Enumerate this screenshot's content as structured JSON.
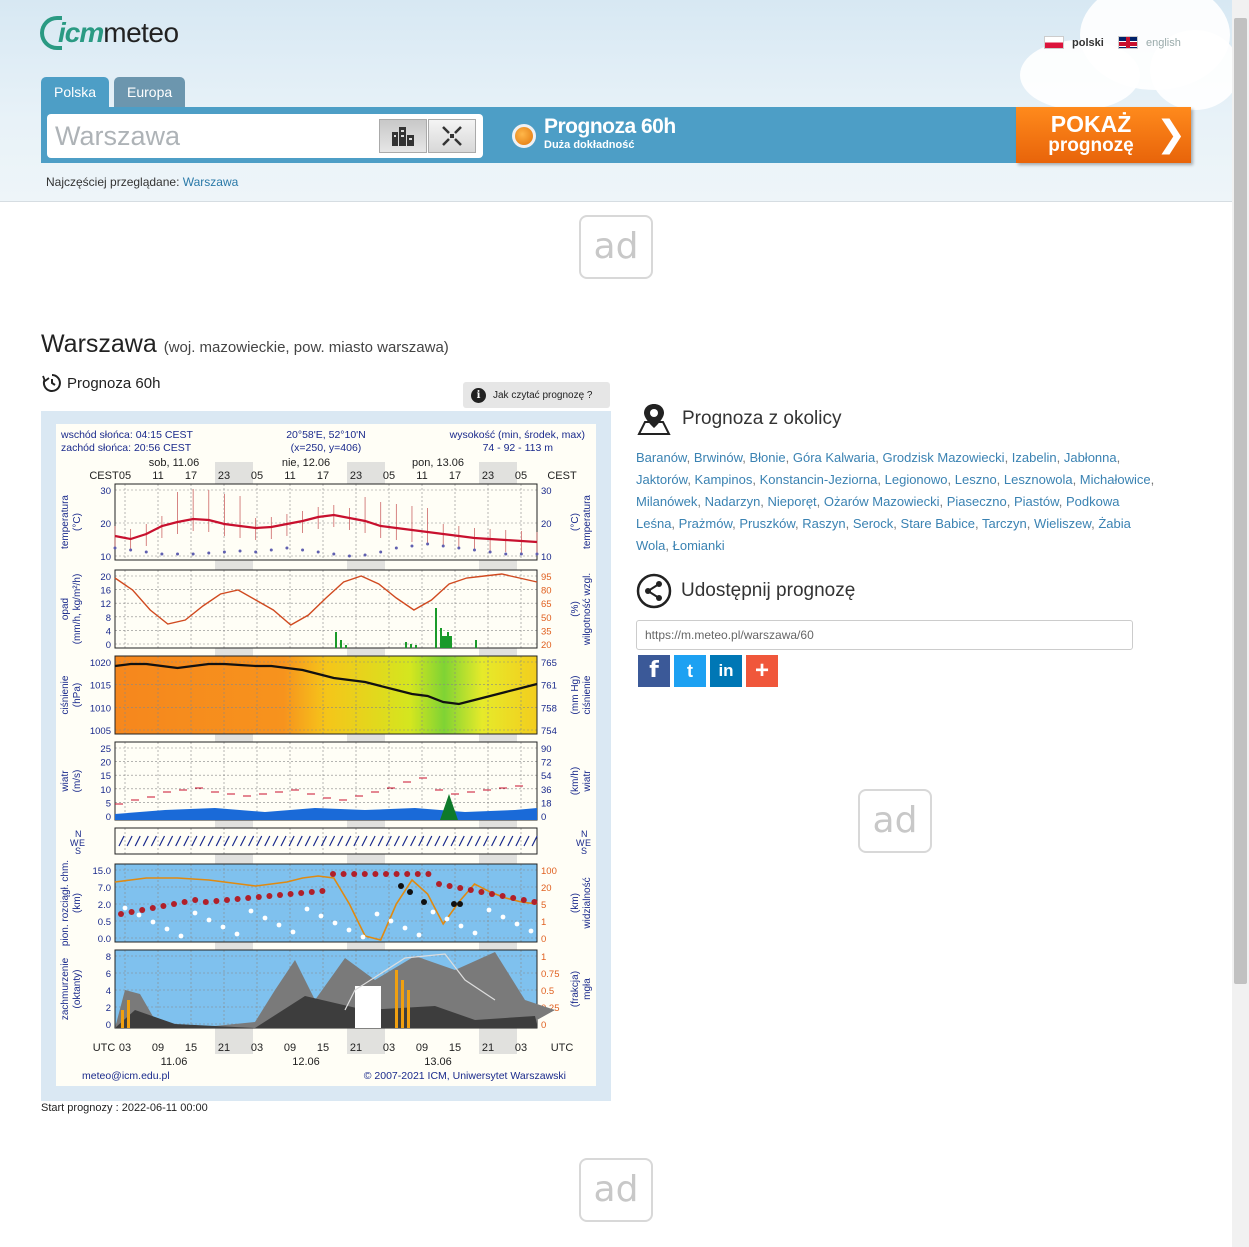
{
  "header": {
    "logo_icm": "icm",
    "logo_meteo": "meteo",
    "lang_pl": "polski",
    "lang_en": "english",
    "tab_poland": "Polska",
    "tab_europe": "Europa",
    "search_placeholder": "Warszawa",
    "forecast_title": "Prognoza 60h",
    "forecast_sub": "Duża dokładność",
    "show_line1": "POKAŻ",
    "show_line2": "prognozę",
    "show_chevron": "❯",
    "recent_label": "Najczęściej przeglądane:",
    "recent_city": "Warszawa"
  },
  "ads": {
    "label": "ad"
  },
  "main": {
    "city": "Warszawa",
    "city_region": "(woj. mazowieckie, pow. miasto warszawa)",
    "forecast_label": "Prognoza 60h",
    "how_to_read": "Jak czytać prognozę ?",
    "start_label": "Start prognozy : 2022-06-11 00:00"
  },
  "meteogram": {
    "sunrise": "wschód słońca: 04:15 CEST",
    "sunset": "zachód słońca: 20:56 CEST",
    "coords": "20°58'E, 52°10'N",
    "grid": "(x=250, y=406)",
    "height_label": "wysokość (min, środek, max)",
    "height_values": "74 - 92 - 113 m",
    "days_top": [
      "sob, 11.06",
      "nie, 12.06",
      "pon, 13.06"
    ],
    "cest": "CEST",
    "utc": "UTC",
    "hours_top": [
      "05",
      "11",
      "17",
      "23",
      "05",
      "11",
      "17",
      "23",
      "05",
      "11",
      "17",
      "23",
      "05"
    ],
    "hours_bottom": [
      "03",
      "09",
      "15",
      "21",
      "03",
      "09",
      "15",
      "21",
      "03",
      "09",
      "15",
      "21",
      "03"
    ],
    "days_bottom": [
      "11.06",
      "12.06",
      "13.06"
    ],
    "panels": [
      {
        "left_label": "temperatura",
        "left_unit": "(°C)",
        "right_label": "temperatura",
        "right_unit": "(°C)",
        "left_ticks": [
          "30",
          "20",
          "10"
        ],
        "right_ticks": [
          "30",
          "20",
          "10"
        ]
      },
      {
        "left_label": "opad",
        "left_unit": "(mm/h, kg/m²/h)",
        "right_label": "wilgotność wzgl.",
        "right_unit": "(%)",
        "left_ticks": [
          "20",
          "16",
          "12",
          "8",
          "4",
          "0"
        ],
        "right_ticks": [
          "95",
          "80",
          "65",
          "50",
          "35",
          "20"
        ]
      },
      {
        "left_label": "ciśnienie",
        "left_unit": "(hPa)",
        "right_label": "ciśnienie",
        "right_unit": "(mm Hg)",
        "left_ticks": [
          "1020",
          "1015",
          "1010",
          "1005"
        ],
        "right_ticks": [
          "765",
          "761",
          "758",
          "754"
        ]
      },
      {
        "left_label": "wiatr",
        "left_unit": "(m/s)",
        "right_label": "wiatr",
        "right_unit": "(km/h)",
        "left_ticks": [
          "25",
          "20",
          "15",
          "10",
          "5",
          "0"
        ],
        "right_ticks": [
          "90",
          "72",
          "54",
          "36",
          "18",
          "0"
        ]
      },
      {
        "left_label": "",
        "left_unit": "",
        "right_label": "",
        "right_unit": "",
        "left_ticks": [
          "N",
          "W",
          "E",
          "S"
        ],
        "right_ticks": [
          "N",
          "W",
          "E",
          "S"
        ]
      },
      {
        "left_label": "pion. rozciągł. chm.",
        "left_unit": "(km)",
        "right_label": "widzialność",
        "right_unit": "(km)",
        "left_ticks": [
          "15.0",
          "7.0",
          "2.0",
          "0.5",
          "0.0"
        ],
        "right_ticks": [
          "100",
          "20",
          "5",
          "1",
          "0"
        ]
      },
      {
        "left_label": "zachmurzenie",
        "left_unit": "(oktanty)",
        "right_label": "mgła",
        "right_unit": "(frakcja)",
        "left_ticks": [
          "8",
          "6",
          "4",
          "2",
          "0"
        ],
        "right_ticks": [
          "1",
          "0.75",
          "0.5",
          "0.25",
          "0"
        ]
      }
    ],
    "footer_email": "meteo@icm.edu.pl",
    "footer_copy": "© 2007-2021 ICM, Uniwersytet Warszawski"
  },
  "sidebar": {
    "nearby_title": "Prognoza z okolicy",
    "towns": [
      "Baranów",
      "Brwinów",
      "Błonie",
      "Góra Kalwaria",
      "Grodzisk Mazowiecki",
      "Izabelin",
      "Jabłonna",
      "Jaktorów",
      "Kampinos",
      "Konstancin-Jeziorna",
      "Legionowo",
      "Leszno",
      "Lesznowola",
      "Michałowice",
      "Milanówek",
      "Nadarzyn",
      "Nieporęt",
      "Ożarów Mazowiecki",
      "Piaseczno",
      "Piastów",
      "Podkowa Leśna",
      "Prażmów",
      "Pruszków",
      "Raszyn",
      "Serock",
      "Stare Babice",
      "Tarczyn",
      "Wieliszew",
      "Żabia Wola",
      "Łomianki"
    ],
    "share_title": "Udostępnij prognozę",
    "share_url": "https://m.meteo.pl/warszawa/60",
    "share_facebook": "f",
    "share_twitter": "t",
    "share_linkedin": "in",
    "share_more": "+"
  },
  "colors": {
    "accent": "#4d9ec6",
    "orange": "#f07a12",
    "link": "#3a82b2"
  }
}
